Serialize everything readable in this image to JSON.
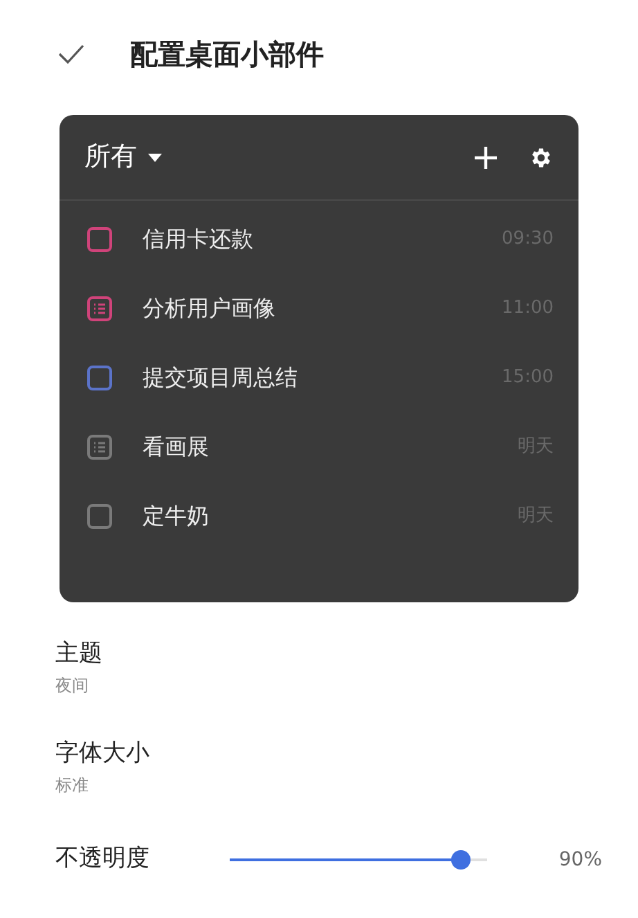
{
  "header": {
    "title": "配置桌面小部件"
  },
  "widget": {
    "filter": "所有",
    "items": [
      {
        "kind": "task",
        "color": "#d0437a",
        "title": "信用卡还款",
        "time": "09:30"
      },
      {
        "kind": "note",
        "color": "#d0437a",
        "title": "分析用户画像",
        "time": "11:00"
      },
      {
        "kind": "task",
        "color": "#5b73c9",
        "title": "提交项目周总结",
        "time": "15:00"
      },
      {
        "kind": "note",
        "color": "#7a7a7a",
        "title": "看画展",
        "time": "明天"
      },
      {
        "kind": "task",
        "color": "#7a7a7a",
        "title": "定牛奶",
        "time": "明天"
      }
    ]
  },
  "settings": [
    {
      "label": "主题",
      "value": "夜间"
    },
    {
      "label": "字体大小",
      "value": "标准"
    }
  ],
  "opacity": {
    "label": "不透明度",
    "level": 0.9,
    "reading": "90%"
  }
}
